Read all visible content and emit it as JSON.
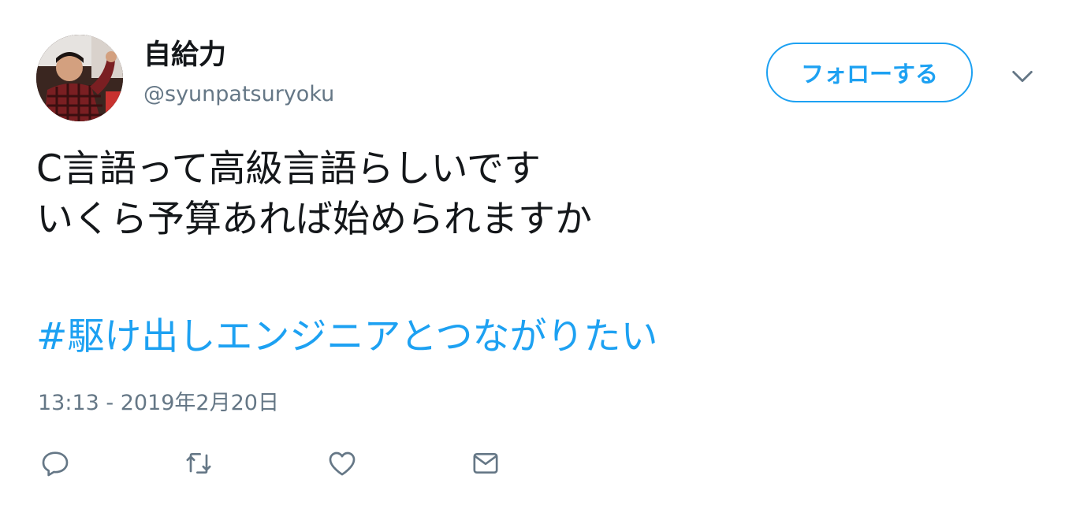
{
  "user": {
    "display_name": "自給力",
    "handle": "@syunpatsuryoku"
  },
  "follow_button": {
    "label": "フォローする"
  },
  "menu": {
    "icon": "chevron-down-icon"
  },
  "tweet": {
    "lines": [
      "C言語って高級言語らしいです",
      "いくら予算あれば始められますか"
    ],
    "hashtag": "#駆け出しエンジニアとつながりたい",
    "timestamp": "13:13 - 2019年2月20日"
  },
  "actions": [
    {
      "icon": "reply-icon"
    },
    {
      "icon": "retweet-icon"
    },
    {
      "icon": "like-icon"
    },
    {
      "icon": "direct-message-icon"
    }
  ],
  "colors": {
    "accent": "#1da1f2",
    "text": "#14171a",
    "secondary_text": "#657786",
    "icon_gray": "#657786"
  }
}
